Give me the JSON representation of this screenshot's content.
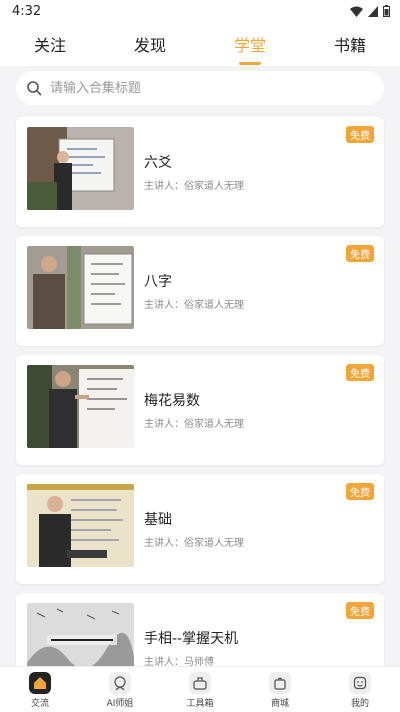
{
  "status_bar": {
    "time": "4:32"
  },
  "tabs": [
    {
      "label": "关注",
      "active": false
    },
    {
      "label": "发现",
      "active": false
    },
    {
      "label": "学堂",
      "active": true
    },
    {
      "label": "书籍",
      "active": false
    }
  ],
  "search": {
    "placeholder": "请输入合集标题"
  },
  "courses": [
    {
      "title": "六爻",
      "presenter": "主讲人：俗家道人无理",
      "badge": "免费"
    },
    {
      "title": "八字",
      "presenter": "主讲人：俗家道人无理",
      "badge": "免费"
    },
    {
      "title": "梅花易数",
      "presenter": "主讲人：俗家道人无理",
      "badge": "免费"
    },
    {
      "title": "基础",
      "presenter": "主讲人：俗家道人无理",
      "badge": "免费"
    },
    {
      "title": "手相--掌握天机",
      "presenter": "主讲人：马师傅",
      "badge": "免费"
    }
  ],
  "bottom_nav": [
    {
      "label": "交流",
      "icon": "home-icon",
      "active": true
    },
    {
      "label": "AI师姐",
      "icon": "ai-assistant-icon",
      "active": false
    },
    {
      "label": "工具箱",
      "icon": "toolbox-icon",
      "active": false
    },
    {
      "label": "商城",
      "icon": "shopping-bag-icon",
      "active": false
    },
    {
      "label": "我的",
      "icon": "profile-icon",
      "active": false
    }
  ],
  "colors": {
    "accent": "#f2a63a",
    "background": "#f3f3f5"
  }
}
